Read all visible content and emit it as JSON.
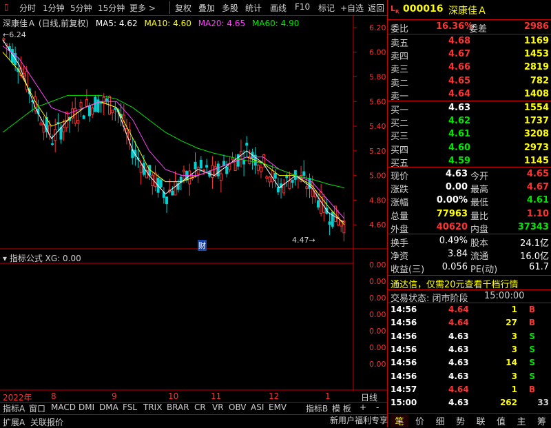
{
  "toolbar": {
    "left_items": [
      "分时",
      "1分钟",
      "5分钟",
      "15分钟",
      "更多 >"
    ],
    "right_items": [
      "复权",
      "叠加",
      "多股",
      "统计",
      "画线",
      "F10",
      "标记",
      "+自选",
      "返回"
    ]
  },
  "chart": {
    "title": "深康佳Ａ (日线,前复权)",
    "ma_legend": [
      {
        "label": "MA5: 4.62",
        "color": "#ffffff"
      },
      {
        "label": "MA10: 4.60",
        "color": "#ffff00"
      },
      {
        "label": "MA20: 4.65",
        "color": "#ff40ff"
      },
      {
        "label": "MA60: 4.90",
        "color": "#00e600"
      }
    ],
    "high_marker": "6.24",
    "low_marker": "4.47",
    "cai_marker": "财",
    "y_ticks": [
      "6.20",
      "6.00",
      "5.80",
      "5.60",
      "5.40",
      "5.20",
      "5.00",
      "4.80",
      "4.60"
    ],
    "indicator_title": "指标公式  XG: 0.00",
    "ind_ticks": [
      "0.00",
      "0.00",
      "0.00",
      "0.00",
      "0.00",
      "0.00",
      "0.00"
    ],
    "x_labels": [
      "2022年",
      "8",
      "9",
      "10",
      "11",
      "12",
      "1"
    ],
    "period_label": "日线"
  },
  "chart_data": {
    "type": "line",
    "title": "深康佳Ａ (日线,前复权)",
    "ylim": [
      4.4,
      6.3
    ],
    "series": [
      {
        "name": "MA5",
        "values": [
          6.1,
          5.9,
          5.55,
          5.3,
          5.45,
          5.55,
          5.6,
          5.55,
          5.2,
          5.0,
          4.85,
          4.95,
          5.05,
          5.0,
          5.1,
          5.2,
          5.1,
          4.9,
          5.0,
          4.9,
          4.7,
          4.62
        ]
      },
      {
        "name": "MA10",
        "values": [
          6.0,
          5.85,
          5.6,
          5.4,
          5.45,
          5.55,
          5.6,
          5.55,
          5.3,
          5.05,
          4.95,
          4.95,
          5.0,
          5.05,
          5.1,
          5.15,
          5.1,
          5.0,
          5.0,
          4.92,
          4.75,
          4.6
        ]
      },
      {
        "name": "MA20",
        "values": [
          6.05,
          5.95,
          5.75,
          5.55,
          5.5,
          5.55,
          5.6,
          5.6,
          5.45,
          5.2,
          5.05,
          5.0,
          5.0,
          5.05,
          5.1,
          5.15,
          5.15,
          5.05,
          5.0,
          4.95,
          4.8,
          4.65
        ]
      },
      {
        "name": "MA60",
        "values": [
          5.35,
          5.45,
          5.55,
          5.6,
          5.65,
          5.65,
          5.65,
          5.62,
          5.55,
          5.45,
          5.35,
          5.28,
          5.22,
          5.18,
          5.15,
          5.12,
          5.1,
          5.05,
          5.0,
          4.97,
          4.93,
          4.9
        ]
      }
    ]
  },
  "bottom_tabs": [
    "指标A",
    "窗口",
    "MACD",
    "DMI",
    "DMA",
    "FSL",
    "TRIX",
    "BRAR",
    "CR",
    "VR",
    "OBV",
    "ASI",
    "EMV",
    "指标B",
    "模 板",
    "+",
    "-"
  ],
  "bottom_row2": [
    "扩展A",
    "关联报价"
  ],
  "panel": {
    "code": "000016",
    "name": "深康佳Ａ",
    "weibi_label": "委比",
    "weibi_value": "16.36%",
    "weicha_label": "委差",
    "weicha_value": "2986",
    "sell": [
      {
        "label": "卖五",
        "price": "4.68",
        "vol": "1169"
      },
      {
        "label": "卖四",
        "price": "4.67",
        "vol": "1453"
      },
      {
        "label": "卖三",
        "price": "4.66",
        "vol": "2819"
      },
      {
        "label": "卖二",
        "price": "4.65",
        "vol": "782"
      },
      {
        "label": "卖一",
        "price": "4.64",
        "vol": "1408"
      }
    ],
    "buy": [
      {
        "label": "买一",
        "price": "4.63",
        "vol": "1554",
        "color": "#ffffff"
      },
      {
        "label": "买二",
        "price": "4.62",
        "vol": "1737",
        "color": "#00e600"
      },
      {
        "label": "买三",
        "price": "4.61",
        "vol": "3208",
        "color": "#00e600"
      },
      {
        "label": "买四",
        "price": "4.60",
        "vol": "2973",
        "color": "#00e600"
      },
      {
        "label": "买五",
        "price": "4.59",
        "vol": "1145",
        "color": "#00e600"
      }
    ],
    "quote": [
      {
        "l1": "现价",
        "v1": "4.63",
        "c1": "#ffffff",
        "l2": "今开",
        "v2": "4.65",
        "c2": "#ff3232"
      },
      {
        "l1": "涨跌",
        "v1": "0.00",
        "c1": "#ffffff",
        "l2": "最高",
        "v2": "4.67",
        "c2": "#ff3232"
      },
      {
        "l1": "涨幅",
        "v1": "0.00%",
        "c1": "#ffffff",
        "l2": "最低",
        "v2": "4.61",
        "c2": "#00e600"
      },
      {
        "l1": "总量",
        "v1": "77963",
        "c1": "#ffff00",
        "l2": "量比",
        "v2": "1.10",
        "c2": "#ff3232"
      },
      {
        "l1": "外盘",
        "v1": "40620",
        "c1": "#ff3232",
        "l2": "内盘",
        "v2": "37343",
        "c2": "#00e600"
      }
    ],
    "fin": [
      {
        "l1": "换手",
        "v1": "0.49%",
        "l2": "股本",
        "v2": "24.1亿"
      },
      {
        "l1": "净资",
        "v1": "3.84",
        "l2": "流通",
        "v2": "16.0亿"
      },
      {
        "l1": "收益(三)",
        "v1": "0.056",
        "l2": "PE(动)",
        "v2": "61.7"
      }
    ],
    "promo": "通达信，仅需20元查看千档行情",
    "status_label": "交易状态: 闭市阶段",
    "status_time": "15:00:00",
    "ticks": [
      {
        "t": "14:56",
        "p": "4.64",
        "pc": "#ff3232",
        "v": "1",
        "d": "B",
        "dc": "#ff3232"
      },
      {
        "t": "14:56",
        "p": "4.64",
        "pc": "#ff3232",
        "v": "27",
        "d": "B",
        "dc": "#ff3232"
      },
      {
        "t": "14:56",
        "p": "4.63",
        "pc": "#ffffff",
        "v": "3",
        "d": "S",
        "dc": "#00e600"
      },
      {
        "t": "14:56",
        "p": "4.63",
        "pc": "#ffffff",
        "v": "3",
        "d": "S",
        "dc": "#00e600"
      },
      {
        "t": "14:56",
        "p": "4.63",
        "pc": "#ffffff",
        "v": "14",
        "d": "S",
        "dc": "#00e600"
      },
      {
        "t": "14:56",
        "p": "4.63",
        "pc": "#ffffff",
        "v": "3",
        "d": "S",
        "dc": "#00e600"
      },
      {
        "t": "14:57",
        "p": "4.64",
        "pc": "#ff3232",
        "v": "1",
        "d": "B",
        "dc": "#ff3232"
      },
      {
        "t": "15:00",
        "p": "4.63",
        "pc": "#ffffff",
        "v": "262",
        "d": "",
        "dc": "#ffffff",
        "last": "33"
      }
    ],
    "bottom_right_text": "新用户福利专享",
    "right_tabs": [
      "笔",
      "价",
      "细",
      "势",
      "联",
      "值",
      "主",
      "筹"
    ]
  }
}
